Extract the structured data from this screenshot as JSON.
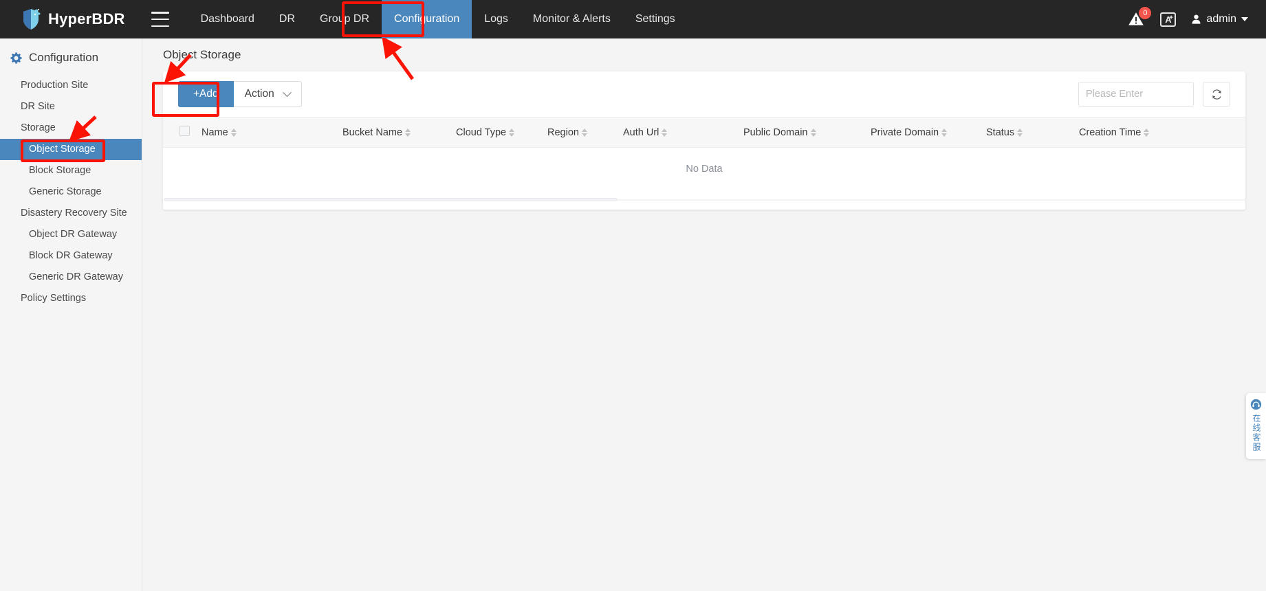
{
  "app": {
    "brand_name": "HyperBDR",
    "logo_icon": "shield-logo-icon",
    "menu_icon": "hamburger-menu-icon"
  },
  "topnav": {
    "tabs": [
      {
        "label": "Dashboard",
        "active": false
      },
      {
        "label": "DR",
        "active": false
      },
      {
        "label": "Group DR",
        "active": false
      },
      {
        "label": "Configuration",
        "active": true
      },
      {
        "label": "Logs",
        "active": false
      },
      {
        "label": "Monitor & Alerts",
        "active": false
      },
      {
        "label": "Settings",
        "active": false
      }
    ],
    "alerts": {
      "icon": "warning-triangle-icon",
      "badge_count": "0"
    },
    "language": {
      "icon": "language-translate-icon",
      "label": "A"
    },
    "user": {
      "icon": "user-avatar-icon",
      "name": "admin",
      "caret": "chevron-down-icon"
    }
  },
  "sidebar": {
    "header": {
      "icon": "configuration-gear-icon",
      "label": "Configuration"
    },
    "items": [
      {
        "label": "Production Site",
        "level": 1,
        "active": false
      },
      {
        "label": "DR Site",
        "level": 1,
        "active": false
      },
      {
        "label": "Storage",
        "level": 1,
        "active": false
      },
      {
        "label": "Object Storage",
        "level": 2,
        "active": true
      },
      {
        "label": "Block Storage",
        "level": 2,
        "active": false
      },
      {
        "label": "Generic Storage",
        "level": 2,
        "active": false
      },
      {
        "label": "Disastery Recovery Site",
        "level": 1,
        "active": false
      },
      {
        "label": "Object DR Gateway",
        "level": 2,
        "active": false
      },
      {
        "label": "Block DR Gateway",
        "level": 2,
        "active": false
      },
      {
        "label": "Generic DR Gateway",
        "level": 2,
        "active": false
      },
      {
        "label": "Policy Settings",
        "level": 1,
        "active": false
      }
    ]
  },
  "main": {
    "page_title": "Object Storage",
    "toolbar": {
      "add_label": "+Add",
      "action_label": "Action",
      "action_caret_icon": "chevron-down-icon",
      "search_placeholder": "Please Enter",
      "search_value": "",
      "search_icon": "search-icon",
      "refresh_icon": "refresh-icon"
    },
    "table": {
      "select_all_checkbox": "header-checkbox",
      "columns": [
        "Name",
        "Bucket Name",
        "Cloud Type",
        "Region",
        "Auth Url",
        "Public Domain",
        "Private Domain",
        "Status",
        "Creation Time"
      ],
      "rows": [],
      "empty_text": "No Data"
    }
  },
  "service_widget": {
    "icon": "headset-support-icon",
    "label": "在线客服"
  },
  "annotations": {
    "highlight_color": "#fb1405",
    "boxes": [
      {
        "name": "configuration-tab-highlight"
      },
      {
        "name": "object-storage-highlight"
      },
      {
        "name": "add-button-highlight"
      }
    ],
    "arrows": [
      {
        "name": "arrow-to-configuration-tab"
      },
      {
        "name": "arrow-to-object-storage"
      },
      {
        "name": "arrow-to-add-button"
      }
    ]
  },
  "colors": {
    "accent_blue": "#4a87bd",
    "topnav_bg": "#262626",
    "annotation_red": "#fb1405",
    "badge_red": "#f5544c"
  }
}
